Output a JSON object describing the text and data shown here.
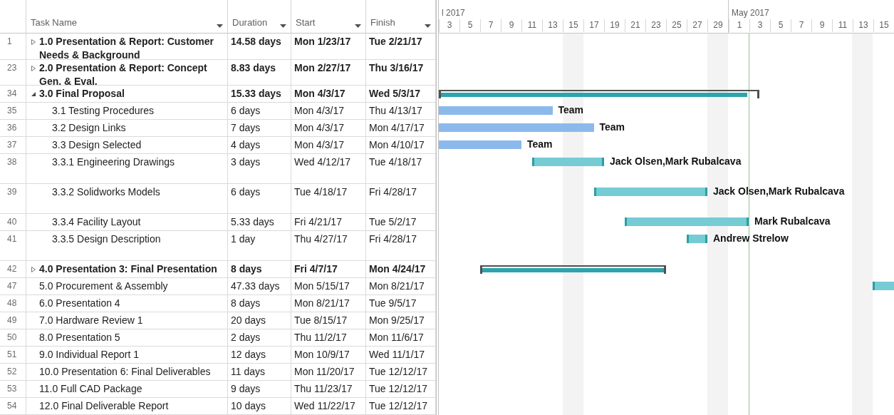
{
  "table": {
    "columns": [
      {
        "label": "Task Name"
      },
      {
        "label": "Duration"
      },
      {
        "label": "Start"
      },
      {
        "label": "Finish"
      }
    ],
    "rows": [
      {
        "id": "1",
        "name": "1.0 Presentation & Report: Customer Needs & Background",
        "duration": "14.58 days",
        "start": "Mon 1/23/17",
        "finish": "Tue 2/21/17",
        "kind": "summary",
        "expanded": false,
        "tall": false
      },
      {
        "id": "23",
        "name": "2.0 Presentation & Report: Concept Gen. & Eval.",
        "duration": "8.83 days",
        "start": "Mon 2/27/17",
        "finish": "Thu 3/16/17",
        "kind": "summary",
        "expanded": false,
        "tall": false
      },
      {
        "id": "34",
        "name": "3.0 Final Proposal",
        "duration": "15.33 days",
        "start": "Mon 4/3/17",
        "finish": "Wed 5/3/17",
        "kind": "summary",
        "expanded": true,
        "tall": false,
        "bar": {
          "kind": "summary",
          "level": 0.97
        },
        "children": [
          {
            "id": "35",
            "name": "3.1 Testing Procedures",
            "duration": "6 days",
            "start": "Mon 4/3/17",
            "finish": "Thu 4/13/17",
            "kind": "task",
            "tall": false,
            "bar": {
              "kind": "task"
            },
            "resources": "Team"
          },
          {
            "id": "36",
            "name": "3.2 Design Links",
            "duration": "7 days",
            "start": "Mon 4/3/17",
            "finish": "Mon 4/17/17",
            "kind": "task",
            "tall": false,
            "bar": {
              "kind": "task"
            },
            "resources": "Team"
          },
          {
            "id": "37",
            "name": "3.3 Design Selected",
            "duration": "4 days",
            "start": "Mon 4/3/17",
            "finish": "Mon 4/10/17",
            "kind": "task",
            "tall": false,
            "bar": {
              "kind": "task"
            },
            "resources": "Team"
          },
          {
            "id": "38",
            "name": "3.3.1 Engineering Drawings",
            "duration": "3 days",
            "start": "Wed 4/12/17",
            "finish": "Tue 4/18/17",
            "kind": "task",
            "tall": true,
            "bar": {
              "kind": "critical"
            },
            "resources": "Jack Olsen,Mark Rubalcava"
          },
          {
            "id": "39",
            "name": "3.3.2 Solidworks Models",
            "duration": "6 days",
            "start": "Tue 4/18/17",
            "finish": "Fri 4/28/17",
            "kind": "task",
            "tall": true,
            "bar": {
              "kind": "critical"
            },
            "resources": "Jack Olsen,Mark Rubalcava"
          },
          {
            "id": "40",
            "name": "3.3.4 Facility Layout",
            "duration": "5.33 days",
            "start": "Fri 4/21/17",
            "finish": "Tue 5/2/17",
            "kind": "task",
            "tall": false,
            "bar": {
              "kind": "critical"
            },
            "resources": "Mark Rubalcava"
          },
          {
            "id": "41",
            "name": "3.3.5 Design Description",
            "duration": "1 day",
            "start": "Thu 4/27/17",
            "finish": "Fri 4/28/17",
            "kind": "task",
            "tall": true,
            "bar": {
              "kind": "critical"
            },
            "resources": "Andrew Strelow"
          }
        ]
      },
      {
        "id": "42",
        "name": "4.0 Presentation 3: Final Presentation",
        "duration": "8 days",
        "start": "Fri 4/7/17",
        "finish": "Mon 4/24/17",
        "kind": "summary",
        "expanded": false,
        "tall": false,
        "bar": {
          "kind": "summary",
          "level": 1
        }
      },
      {
        "id": "47",
        "name": "5.0 Procurement & Assembly",
        "duration": "47.33 days",
        "start": "Mon 5/15/17",
        "finish": "Mon 8/21/17",
        "kind": "task",
        "tall": false,
        "bar": {
          "kind": "critical"
        }
      },
      {
        "id": "48",
        "name": "6.0 Presentation 4",
        "duration": "8 days",
        "start": "Mon 8/21/17",
        "finish": "Tue 9/5/17",
        "kind": "task",
        "tall": false
      },
      {
        "id": "49",
        "name": "7.0 Hardware Review 1",
        "duration": "20 days",
        "start": "Tue 8/15/17",
        "finish": "Mon 9/25/17",
        "kind": "task",
        "tall": false
      },
      {
        "id": "50",
        "name": "8.0  Presentation 5",
        "duration": "2 days",
        "start": "Thu 11/2/17",
        "finish": "Mon 11/6/17",
        "kind": "task",
        "tall": false
      },
      {
        "id": "51",
        "name": "9.0 Individual Report 1",
        "duration": "12 days",
        "start": "Mon 10/9/17",
        "finish": "Wed 11/1/17",
        "kind": "task",
        "tall": false
      },
      {
        "id": "52",
        "name": "10.0 Presentation 6: Final Deliverables",
        "duration": "11 days",
        "start": "Mon 11/20/17",
        "finish": "Tue 12/12/17",
        "kind": "task",
        "tall": false
      },
      {
        "id": "53",
        "name": "11.0 Full CAD Package",
        "duration": "9 days",
        "start": "Thu 11/23/17",
        "finish": "Tue 12/12/17",
        "kind": "task",
        "tall": false
      },
      {
        "id": "54",
        "name": "12.0 Final Deliverable Report",
        "duration": "10 days",
        "start": "Wed 11/22/17",
        "finish": "Tue 12/12/17",
        "kind": "task",
        "tall": false
      }
    ]
  },
  "gantt": {
    "months": [
      {
        "label": "l 2017",
        "days": [
          {
            "label": "3",
            "shaded": false
          },
          {
            "label": "5",
            "shaded": false
          },
          {
            "label": "7",
            "shaded": false
          },
          {
            "label": "9",
            "shaded": false
          },
          {
            "label": "11",
            "shaded": false
          },
          {
            "label": "13",
            "shaded": false
          },
          {
            "label": "15",
            "shaded": true
          },
          {
            "label": "17",
            "shaded": false
          },
          {
            "label": "19",
            "shaded": false
          },
          {
            "label": "21",
            "shaded": false
          },
          {
            "label": "23",
            "shaded": false
          },
          {
            "label": "25",
            "shaded": false
          },
          {
            "label": "27",
            "shaded": false
          },
          {
            "label": "29",
            "shaded": true
          }
        ]
      },
      {
        "label": "May 2017",
        "days": [
          {
            "label": "1",
            "shaded": false
          },
          {
            "label": "3",
            "shaded": false
          },
          {
            "label": "5",
            "shaded": false
          },
          {
            "label": "7",
            "shaded": false
          },
          {
            "label": "9",
            "shaded": false
          },
          {
            "label": "11",
            "shaded": false
          },
          {
            "label": "13",
            "shaded": true
          },
          {
            "label": "15",
            "shaded": false
          }
        ]
      }
    ]
  }
}
